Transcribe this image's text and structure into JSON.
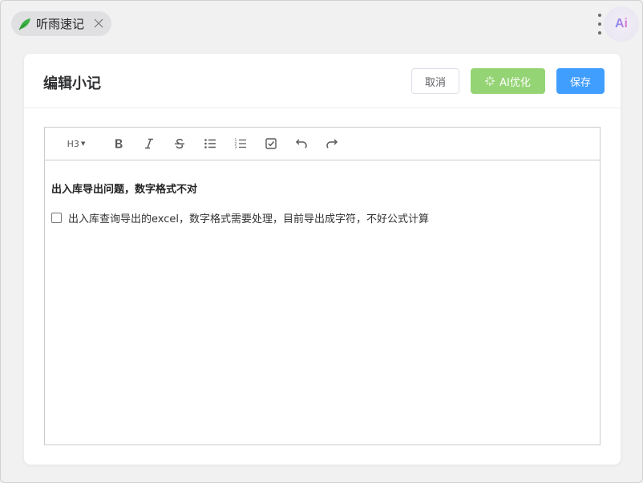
{
  "app": {
    "tab_title": "听雨速记",
    "ai_badge": "Ai"
  },
  "dialog": {
    "title": "编辑小记",
    "buttons": {
      "cancel": "取消",
      "ai_optimize": "AI优化",
      "save": "保存"
    }
  },
  "toolbar": {
    "heading_select": "H3",
    "tools": [
      "bold-icon",
      "italic-icon",
      "strikethrough-icon",
      "bullet-list-icon",
      "numbered-list-icon",
      "todo-icon",
      "undo-icon",
      "redo-icon"
    ]
  },
  "document": {
    "heading": "出入库导出问题，数字格式不对",
    "todo_item": {
      "checked": false,
      "text": "出入库查询导出的excel，数字格式需要处理，目前导出成字符，不好公式计算"
    }
  },
  "colors": {
    "save_button": "#409eff",
    "ai_button": "#95d475",
    "logo": "#3cb043"
  }
}
